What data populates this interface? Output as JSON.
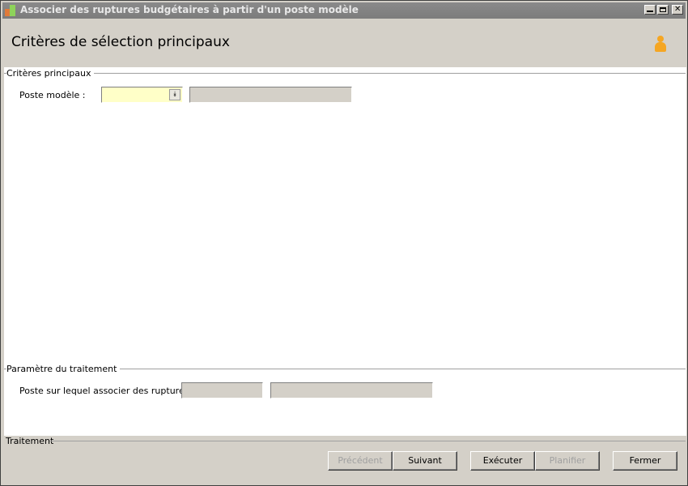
{
  "window": {
    "title": "Associer des ruptures budgétaires à partir d'un poste modèle",
    "controls": {
      "minimize": "_",
      "maximize": "□",
      "close": "✕"
    }
  },
  "header": {
    "title": "Critères de sélection principaux",
    "icon": "user-icon"
  },
  "criteria": {
    "section_title": "Critères principaux",
    "poste_modele_label": "Poste modèle :",
    "poste_modele_value": "",
    "poste_modele_description": ""
  },
  "parameters": {
    "section_title": "Paramètre du traitement",
    "poste_label": "Poste sur lequel associer des ruptures :",
    "poste_code": "",
    "poste_description": ""
  },
  "footer": {
    "section_title": "Traitement",
    "buttons": {
      "previous": "Précédent",
      "next": "Suivant",
      "execute": "Exécuter",
      "schedule": "Planifier",
      "close": "Fermer"
    }
  },
  "colors": {
    "combo_bg": "#ffffc8",
    "title_bar": "#808080",
    "user_icon": "#f5a623"
  }
}
